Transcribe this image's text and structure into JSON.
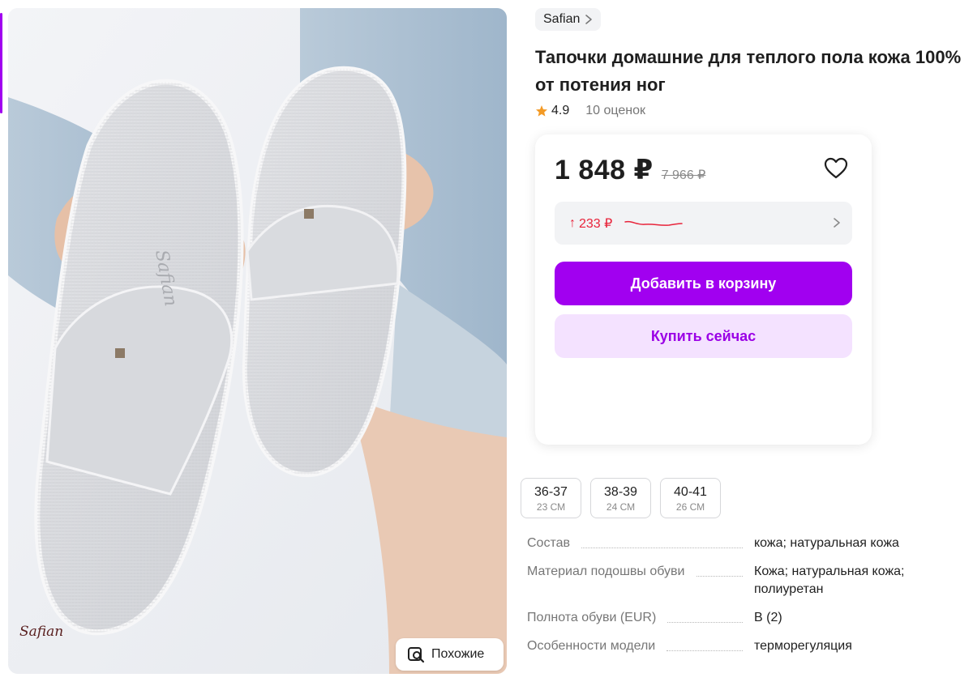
{
  "photo": {
    "watermark": "Safian",
    "similar_label": "Похожие"
  },
  "brand": {
    "name": "Safian"
  },
  "product": {
    "title": "Тапочки домашние для теплого пола кожа 100% от потения ног",
    "rating": "4.9",
    "reviews": "10 оценок"
  },
  "pricing": {
    "price": "1 848 ₽",
    "old_price": "7 966 ₽",
    "wallet_arrow": "↑",
    "wallet_amount": "233 ₽",
    "add_to_cart": "Добавить в корзину",
    "buy_now": "Купить сейчас"
  },
  "sizes": [
    {
      "eu": "36-37",
      "cm": "23 СМ"
    },
    {
      "eu": "38-39",
      "cm": "24 СМ"
    },
    {
      "eu": "40-41",
      "cm": "26 СМ"
    }
  ],
  "specs": [
    {
      "key": "Состав",
      "value": "кожа; натуральная кожа"
    },
    {
      "key": "Материал подошвы обуви",
      "value": "Кожа; натуральная кожа; полиуретан"
    },
    {
      "key": "Полнота обуви (EUR)",
      "value": "B (2)"
    },
    {
      "key": "Особенности модели",
      "value": "терморегуляция"
    }
  ],
  "colors": {
    "accent": "#a100f0",
    "accent_light": "#f4e2ff",
    "wallet_red": "#e8233a",
    "star": "#f39a25"
  },
  "icons": {
    "similar": "image-search-icon",
    "brand_arrow": "chevron-right-icon",
    "favorite": "heart-icon",
    "rating": "star-icon"
  }
}
